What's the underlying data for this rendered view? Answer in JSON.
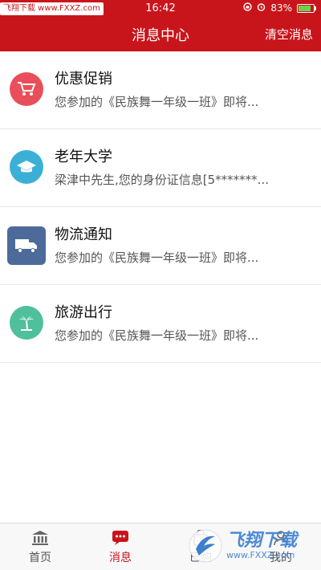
{
  "status_bar": {
    "watermark": "飞翔下载 www.FXXZ.com",
    "time": "16:42",
    "battery_percent": "83%",
    "battery_level": 0.83
  },
  "nav": {
    "title": "消息中心",
    "action": "清空消息"
  },
  "messages": [
    {
      "title": "优惠促销",
      "desc": "您参加的《民族舞一年级一班》即将...",
      "icon": "cart-icon",
      "color": "#e94f5a"
    },
    {
      "title": "老年大学",
      "desc": "梁津中先生,您的身份证信息[5*******...",
      "icon": "graduation-cap-icon",
      "color": "#3bb0d6"
    },
    {
      "title": "物流通知",
      "desc": "您参加的《民族舞一年级一班》即将...",
      "icon": "truck-icon",
      "color": "#4d6b9a"
    },
    {
      "title": "旅游出行",
      "desc": "您参加的《民族舞一年级一班》即将...",
      "icon": "palm-tree-icon",
      "color": "#4fbf9c"
    }
  ],
  "tabs": [
    {
      "label": "首页",
      "icon": "bank-icon"
    },
    {
      "label": "消息",
      "icon": "message-icon",
      "active": true
    },
    {
      "label": "已购",
      "icon": "bag-icon"
    },
    {
      "label": "我的",
      "icon": "user-icon"
    }
  ],
  "watermark_bottom": {
    "brand": "飞翔下载",
    "url": "www.FXXZ.com"
  }
}
